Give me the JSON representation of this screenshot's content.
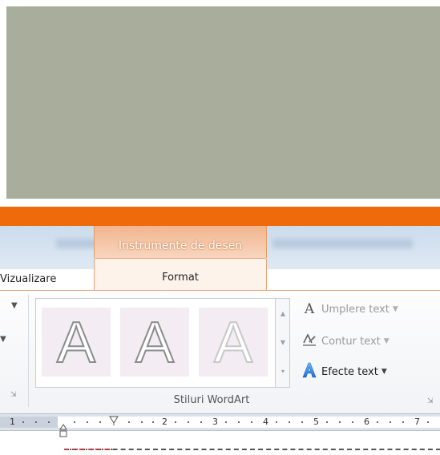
{
  "colors": {
    "gray_panel": "#a8ae9b",
    "title_bar": "#ef6a0a",
    "context_tab": "#f1b58d",
    "ribbon": "#f6f7f9"
  },
  "tabs": {
    "view_label": "Vizualizare",
    "format_label": "Format",
    "context_group_label": "Instrumente de desen"
  },
  "wordart_group": {
    "label": "Stiluri WordArt",
    "styles": [
      {
        "letter": "A",
        "variant": "outline-gray"
      },
      {
        "letter": "A",
        "variant": "outline-gray"
      },
      {
        "letter": "A",
        "variant": "outline-faded"
      }
    ],
    "commands": [
      {
        "label": "Umplere text",
        "icon": "text-fill-icon",
        "enabled": false
      },
      {
        "label": "Contur text",
        "icon": "text-outline-icon",
        "enabled": false
      },
      {
        "label": "Efecte text",
        "icon": "text-effects-icon",
        "enabled": true
      }
    ]
  },
  "ruler": {
    "numbers": [
      "1",
      "2",
      "3",
      "4",
      "5",
      "6",
      "7"
    ]
  }
}
